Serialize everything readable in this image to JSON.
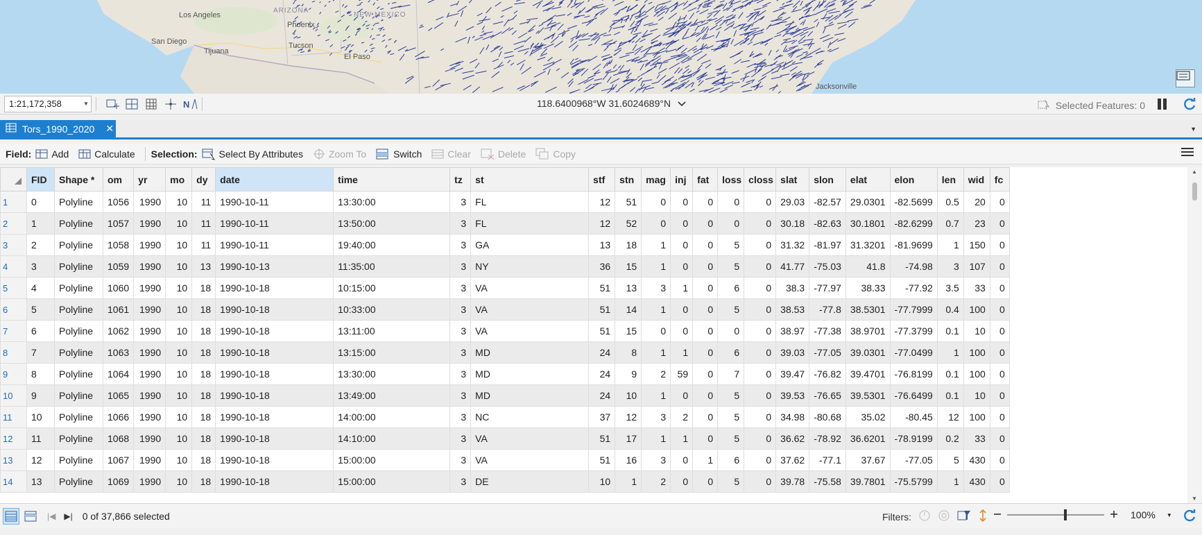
{
  "map": {
    "cities": [
      "Los Angeles",
      "San Diego",
      "Tijuana",
      "Phoenix",
      "Tucson",
      "El Paso",
      "Jacksonville"
    ],
    "states": [
      "ARIZONA",
      "NEW MEXICO"
    ]
  },
  "mapbar": {
    "scale": "1:21,172,358",
    "coords": "118.6400968°W 31.6024689°N",
    "selected_features": "Selected Features: 0"
  },
  "tab": {
    "title": "Tors_1990_2020"
  },
  "toolbar": {
    "field_label": "Field:",
    "add": "Add",
    "calculate": "Calculate",
    "selection_label": "Selection:",
    "select_by_attributes": "Select By Attributes",
    "zoom_to": "Zoom To",
    "switch": "Switch",
    "clear": "Clear",
    "delete": "Delete",
    "copy": "Copy"
  },
  "table": {
    "columns": [
      "FID",
      "Shape *",
      "om",
      "yr",
      "mo",
      "dy",
      "date",
      "time",
      "tz",
      "st",
      "stf",
      "stn",
      "mag",
      "inj",
      "fat",
      "loss",
      "closs",
      "slat",
      "slon",
      "elat",
      "elon",
      "len",
      "wid",
      "fc"
    ],
    "rows": [
      [
        "1",
        "0",
        "Polyline",
        "1056",
        "1990",
        "10",
        "11",
        "1990-10-11",
        "13:30:00",
        "3",
        "FL",
        "12",
        "51",
        "0",
        "0",
        "0",
        "0",
        "0",
        "29.03",
        "-82.57",
        "29.0301",
        "-82.5699",
        "0.5",
        "20",
        "0"
      ],
      [
        "2",
        "1",
        "Polyline",
        "1057",
        "1990",
        "10",
        "11",
        "1990-10-11",
        "13:50:00",
        "3",
        "FL",
        "12",
        "52",
        "0",
        "0",
        "0",
        "0",
        "0",
        "30.18",
        "-82.63",
        "30.1801",
        "-82.6299",
        "0.7",
        "23",
        "0"
      ],
      [
        "3",
        "2",
        "Polyline",
        "1058",
        "1990",
        "10",
        "11",
        "1990-10-11",
        "19:40:00",
        "3",
        "GA",
        "13",
        "18",
        "1",
        "0",
        "0",
        "5",
        "0",
        "31.32",
        "-81.97",
        "31.3201",
        "-81.9699",
        "1",
        "150",
        "0"
      ],
      [
        "4",
        "3",
        "Polyline",
        "1059",
        "1990",
        "10",
        "13",
        "1990-10-13",
        "11:35:00",
        "3",
        "NY",
        "36",
        "15",
        "1",
        "0",
        "0",
        "5",
        "0",
        "41.77",
        "-75.03",
        "41.8",
        "-74.98",
        "3",
        "107",
        "0"
      ],
      [
        "5",
        "4",
        "Polyline",
        "1060",
        "1990",
        "10",
        "18",
        "1990-10-18",
        "10:15:00",
        "3",
        "VA",
        "51",
        "13",
        "3",
        "1",
        "0",
        "6",
        "0",
        "38.3",
        "-77.97",
        "38.33",
        "-77.92",
        "3.5",
        "33",
        "0"
      ],
      [
        "6",
        "5",
        "Polyline",
        "1061",
        "1990",
        "10",
        "18",
        "1990-10-18",
        "10:33:00",
        "3",
        "VA",
        "51",
        "14",
        "1",
        "0",
        "0",
        "5",
        "0",
        "38.53",
        "-77.8",
        "38.5301",
        "-77.7999",
        "0.4",
        "100",
        "0"
      ],
      [
        "7",
        "6",
        "Polyline",
        "1062",
        "1990",
        "10",
        "18",
        "1990-10-18",
        "13:11:00",
        "3",
        "VA",
        "51",
        "15",
        "0",
        "0",
        "0",
        "0",
        "0",
        "38.97",
        "-77.38",
        "38.9701",
        "-77.3799",
        "0.1",
        "10",
        "0"
      ],
      [
        "8",
        "7",
        "Polyline",
        "1063",
        "1990",
        "10",
        "18",
        "1990-10-18",
        "13:15:00",
        "3",
        "MD",
        "24",
        "8",
        "1",
        "1",
        "0",
        "6",
        "0",
        "39.03",
        "-77.05",
        "39.0301",
        "-77.0499",
        "1",
        "100",
        "0"
      ],
      [
        "9",
        "8",
        "Polyline",
        "1064",
        "1990",
        "10",
        "18",
        "1990-10-18",
        "13:30:00",
        "3",
        "MD",
        "24",
        "9",
        "2",
        "59",
        "0",
        "7",
        "0",
        "39.47",
        "-76.82",
        "39.4701",
        "-76.8199",
        "0.1",
        "100",
        "0"
      ],
      [
        "10",
        "9",
        "Polyline",
        "1065",
        "1990",
        "10",
        "18",
        "1990-10-18",
        "13:49:00",
        "3",
        "MD",
        "24",
        "10",
        "1",
        "0",
        "0",
        "5",
        "0",
        "39.53",
        "-76.65",
        "39.5301",
        "-76.6499",
        "0.1",
        "10",
        "0"
      ],
      [
        "11",
        "10",
        "Polyline",
        "1066",
        "1990",
        "10",
        "18",
        "1990-10-18",
        "14:00:00",
        "3",
        "NC",
        "37",
        "12",
        "3",
        "2",
        "0",
        "5",
        "0",
        "34.98",
        "-80.68",
        "35.02",
        "-80.45",
        "12",
        "100",
        "0"
      ],
      [
        "12",
        "11",
        "Polyline",
        "1068",
        "1990",
        "10",
        "18",
        "1990-10-18",
        "14:10:00",
        "3",
        "VA",
        "51",
        "17",
        "1",
        "1",
        "0",
        "5",
        "0",
        "36.62",
        "-78.92",
        "36.6201",
        "-78.9199",
        "0.2",
        "33",
        "0"
      ],
      [
        "13",
        "12",
        "Polyline",
        "1067",
        "1990",
        "10",
        "18",
        "1990-10-18",
        "15:00:00",
        "3",
        "VA",
        "51",
        "16",
        "3",
        "0",
        "1",
        "6",
        "0",
        "37.62",
        "-77.1",
        "37.67",
        "-77.05",
        "5",
        "430",
        "0"
      ],
      [
        "14",
        "13",
        "Polyline",
        "1069",
        "1990",
        "10",
        "18",
        "1990-10-18",
        "15:00:00",
        "3",
        "DE",
        "10",
        "1",
        "2",
        "0",
        "0",
        "5",
        "0",
        "39.78",
        "-75.58",
        "39.7801",
        "-75.5799",
        "1",
        "430",
        "0"
      ]
    ]
  },
  "bottombar": {
    "selected": "0 of 37,866 selected",
    "filters_label": "Filters:",
    "zoom": "100%",
    "zoom_level": 0.6
  }
}
